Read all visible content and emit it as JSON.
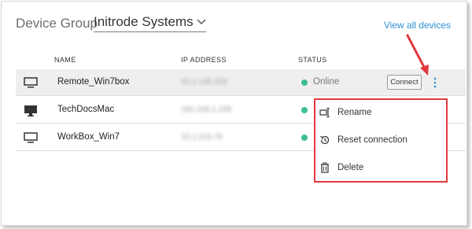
{
  "header": {
    "label": "Device Group",
    "group_value": "Initrode Systems",
    "view_all_link": "View all devices"
  },
  "table": {
    "columns": [
      "NAME",
      "IP ADDRESS",
      "STATUS"
    ],
    "rows": [
      {
        "name": "Remote_Win7box",
        "ip": "10.1.145.229",
        "status": "Online",
        "status_color": "#3dbf8f"
      },
      {
        "name": "TechDocsMac",
        "ip": "192.168.1.159",
        "status": "",
        "status_color": "#3dbf8f"
      },
      {
        "name": "WorkBox_Win7",
        "ip": "10.1.215.76",
        "status": "",
        "status_color": "#3dbf8f"
      }
    ]
  },
  "row_actions": {
    "connect_label": "Connect"
  },
  "context_menu": {
    "items": [
      {
        "label": "Rename",
        "icon": "rename-icon"
      },
      {
        "label": "Reset connection",
        "icon": "history-icon"
      },
      {
        "label": "Delete",
        "icon": "trash-icon"
      }
    ]
  },
  "colors": {
    "accent_link": "#2a8fd3",
    "highlight_red": "#e0393e",
    "online_green": "#3dbf8f"
  }
}
